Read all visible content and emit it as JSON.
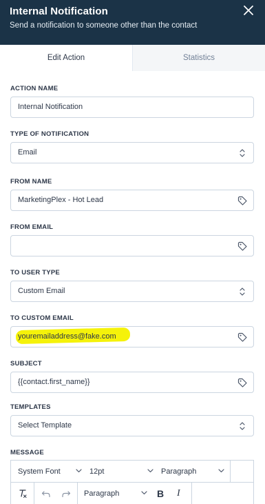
{
  "header": {
    "title": "Internal Notification",
    "subtitle": "Send a notification to someone other than the contact"
  },
  "tabs": [
    {
      "label": "Edit Action",
      "active": true
    },
    {
      "label": "Statistics",
      "active": false
    }
  ],
  "form": {
    "action_name": {
      "label": "ACTION NAME",
      "value": "Internal Notification"
    },
    "notification_type": {
      "label": "TYPE OF NOTIFICATION",
      "value": "Email"
    },
    "from_name": {
      "label": "FROM NAME",
      "value": "MarketingPlex - Hot Lead"
    },
    "from_email": {
      "label": "FROM EMAIL",
      "value": ""
    },
    "user_type": {
      "label": "TO USER TYPE",
      "value": "Custom Email"
    },
    "custom_email": {
      "label": "TO CUSTOM EMAIL",
      "value": "youremailaddress@fake.com"
    },
    "subject": {
      "label": "SUBJECT",
      "value": "{{contact.first_name}}"
    },
    "templates": {
      "label": "TEMPLATES",
      "value": "Select Template"
    },
    "message": {
      "label": "MESSAGE"
    }
  },
  "editor": {
    "font_family": "System Font",
    "font_size": "12pt",
    "block_format": "Paragraph",
    "block_format_2": "Paragraph",
    "bold": "B",
    "italic": "I"
  },
  "colors": {
    "header_bg": "#1b3347",
    "highlight": "#f5f20a",
    "border": "#cbd5e0"
  },
  "icons": [
    "close-icon",
    "tag-icon",
    "select-arrows-icon",
    "clear-format-icon",
    "undo-icon",
    "redo-icon",
    "chevron-down-icon"
  ]
}
